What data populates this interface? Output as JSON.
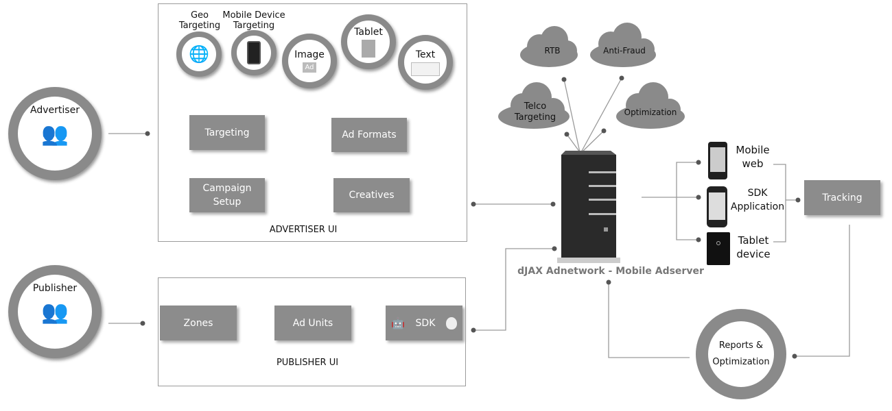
{
  "actors": {
    "advertiser": "Advertiser",
    "publisher": "Publisher"
  },
  "advertiser_ui": {
    "label": "ADVERTISER UI",
    "targeting_options": [
      {
        "label_1": "Geo",
        "label_2": "Targeting",
        "icon": "globe-target-icon"
      },
      {
        "label_1": "Mobile Device",
        "label_2": "Targeting",
        "icon": "smartphone-target-icon"
      }
    ],
    "ad_formats": [
      {
        "label": "Image",
        "icon_text": "Ad",
        "icon": "image-ad-icon"
      },
      {
        "label": "Tablet",
        "icon": "tablet-icon"
      },
      {
        "label": "Text",
        "icon": "text-ad-icon"
      }
    ],
    "boxes": {
      "targeting": "Targeting",
      "ad_formats": "Ad Formats",
      "campaign_setup_1": "Campaign",
      "campaign_setup_2": "Setup",
      "creatives": "Creatives"
    }
  },
  "publisher_ui": {
    "label": "PUBLISHER UI",
    "boxes": {
      "zones": "Zones",
      "ad_units": "Ad Units",
      "sdk": "SDK"
    }
  },
  "clouds": {
    "rtb": "RTB",
    "anti_fraud": "Anti-Fraud",
    "telco_1": "Telco",
    "telco_2": "Targeting",
    "optimization": "Optimization"
  },
  "server": {
    "caption": "dJAX Adnetwork - Mobile Adserver"
  },
  "devices": [
    {
      "label_1": "Mobile",
      "label_2": "web"
    },
    {
      "label_1": "SDK",
      "label_2": "Application"
    },
    {
      "label_1": "Tablet",
      "label_2": "device"
    }
  ],
  "tracking": "Tracking",
  "reports": {
    "label_1": "Reports &",
    "label_2": "Optimization"
  },
  "colors": {
    "box": "#8c8c8c",
    "ring": "#8a8a8a",
    "line": "#9a9a9a",
    "dot": "#555555"
  }
}
